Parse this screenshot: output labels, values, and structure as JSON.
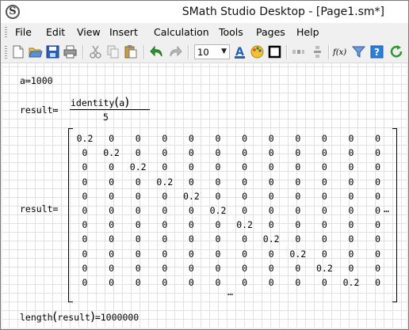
{
  "window": {
    "title": "SMath Studio Desktop - [Page1.sm*]",
    "icon_letter": "S"
  },
  "menu": [
    {
      "label": "File"
    },
    {
      "label": "Edit"
    },
    {
      "label": "View"
    },
    {
      "label": "Insert"
    },
    {
      "label": "Calculation"
    },
    {
      "label": "Tools"
    },
    {
      "label": "Pages"
    },
    {
      "label": "Help"
    }
  ],
  "toolbar": {
    "icons": [
      "new-document-icon",
      "open-folder-icon",
      "save-icon",
      "print-icon",
      "cut-icon",
      "copy-icon",
      "paste-icon",
      "undo-icon",
      "redo-icon",
      "font-size-select",
      "font-color-icon",
      "fill-color-icon",
      "border-icon",
      "align-icon",
      "distribute-icon",
      "function-icon",
      "filter-icon",
      "help-icon",
      "recalculate-icon"
    ],
    "font_size": "10",
    "function_label": "f(x)",
    "text_color_label": "A",
    "colors": {
      "accent_blue": "#1f5fbf",
      "green": "#2e9a2e",
      "yellow": "#f2c230"
    }
  },
  "sheet": {
    "assign_a": {
      "var": "a",
      "op": "≔",
      "value": "1000"
    },
    "assign_result": {
      "var": "result",
      "op": "≔",
      "numerator_func": "identity",
      "numerator_arg": "a",
      "denominator": "5"
    },
    "matrix": {
      "lhs": "result",
      "op": "=",
      "rows": [
        [
          "0.2",
          "0",
          "0",
          "0",
          "0",
          "0",
          "0",
          "0",
          "0",
          "0",
          "0",
          "0"
        ],
        [
          "0",
          "0.2",
          "0",
          "0",
          "0",
          "0",
          "0",
          "0",
          "0",
          "0",
          "0",
          "0"
        ],
        [
          "0",
          "0",
          "0.2",
          "0",
          "0",
          "0",
          "0",
          "0",
          "0",
          "0",
          "0",
          "0"
        ],
        [
          "0",
          "0",
          "0",
          "0.2",
          "0",
          "0",
          "0",
          "0",
          "0",
          "0",
          "0",
          "0"
        ],
        [
          "0",
          "0",
          "0",
          "0",
          "0.2",
          "0",
          "0",
          "0",
          "0",
          "0",
          "0",
          "0"
        ],
        [
          "0",
          "0",
          "0",
          "0",
          "0",
          "0.2",
          "0",
          "0",
          "0",
          "0",
          "0",
          "0"
        ],
        [
          "0",
          "0",
          "0",
          "0",
          "0",
          "0",
          "0.2",
          "0",
          "0",
          "0",
          "0",
          "0"
        ],
        [
          "0",
          "0",
          "0",
          "0",
          "0",
          "0",
          "0",
          "0.2",
          "0",
          "0",
          "0",
          "0"
        ],
        [
          "0",
          "0",
          "0",
          "0",
          "0",
          "0",
          "0",
          "0",
          "0.2",
          "0",
          "0",
          "0"
        ],
        [
          "0",
          "0",
          "0",
          "0",
          "0",
          "0",
          "0",
          "0",
          "0",
          "0.2",
          "0",
          "0"
        ],
        [
          "0",
          "0",
          "0",
          "0",
          "0",
          "0",
          "0",
          "0",
          "0",
          "0",
          "0.2",
          "0"
        ]
      ],
      "row_ellipsis": "…",
      "col_ellipsis": "…"
    },
    "length_expr": {
      "func": "length",
      "arg": "result",
      "op": "=",
      "value": "1000000"
    }
  }
}
